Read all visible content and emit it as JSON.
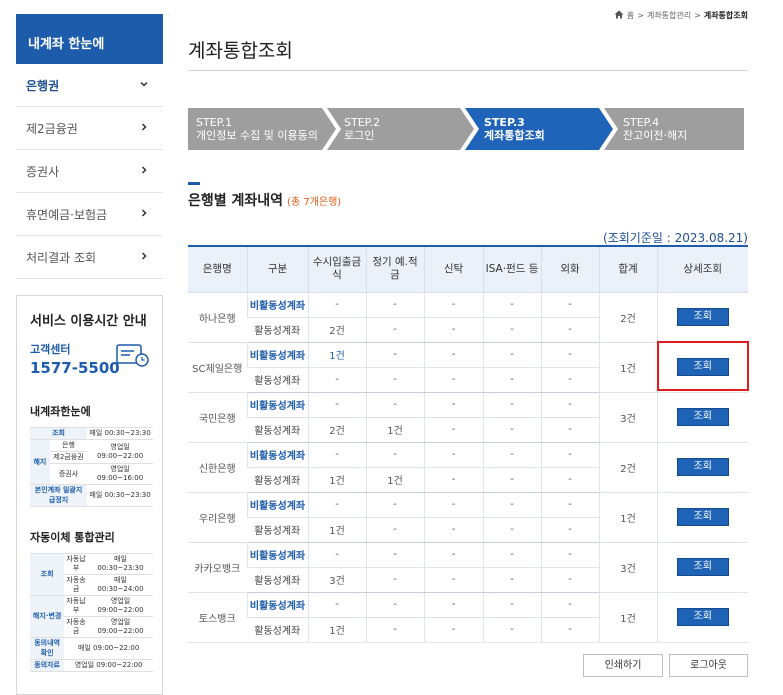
{
  "sidebar": {
    "header": "내계좌 한눈에",
    "items": [
      {
        "label": "은행권",
        "chevron": "⌄"
      },
      {
        "label": "제2금융권",
        "chevron": "›"
      },
      {
        "label": "증권사",
        "chevron": "›"
      },
      {
        "label": "휴면예금·보험금",
        "chevron": "›"
      },
      {
        "label": "처리결과 조회",
        "chevron": "›"
      }
    ],
    "service": {
      "title": "서비스 이용시간 안내",
      "center_label": "고객센터",
      "center_phone": "1577-5500",
      "section1_title": "내계좌한눈에",
      "section1_rows": [
        {
          "cat": "조회",
          "sub": "",
          "time": "매일 00:30~23:30"
        },
        {
          "cat": "해지",
          "sub": "은행",
          "time": "영업일 09:00~22:00"
        },
        {
          "cat": "",
          "sub": "제2금융권",
          "time": ""
        },
        {
          "cat": "",
          "sub": "증권사",
          "time": "영업일 09:00~16:00"
        },
        {
          "cat": "본인계좌 일괄지급정지",
          "sub": "",
          "time": "매일 00:30~23:30"
        }
      ],
      "section2_title": "자동이체 통합관리",
      "section2_rows": [
        {
          "cat": "조회",
          "sub": "자동납부",
          "time": "매일 00:30~23:30"
        },
        {
          "cat": "",
          "sub": "자동송금",
          "time": "매일 00:30~24:00"
        },
        {
          "cat": "해지·변경",
          "sub": "자동납부",
          "time": "영업일 09:00~22:00"
        },
        {
          "cat": "",
          "sub": "자동송금",
          "time": "영업일 09:00~22:00"
        },
        {
          "cat": "동의내역 확인",
          "sub": "",
          "time": "매일 09:00~22:00"
        },
        {
          "cat": "동의자료",
          "sub": "",
          "time": "영업일 09:00~22:00"
        }
      ]
    }
  },
  "breadcrumb": {
    "home_icon": "home-icon",
    "items": [
      "홈",
      "계좌통합관리",
      "계좌통합조회"
    ]
  },
  "page_title": "계좌통합조회",
  "steps": [
    {
      "line1": "STEP.1",
      "line2": "개인정보 수집 및 이용동의",
      "state": "done"
    },
    {
      "line1": "STEP.2",
      "line2": "로그인",
      "state": "done"
    },
    {
      "line1": "STEP.3",
      "line2": "계좌통합조회",
      "state": "current"
    },
    {
      "line1": "STEP.4",
      "line2": "잔고이전·해지",
      "state": "todo"
    }
  ],
  "section": {
    "title": "은행별 계좌내역",
    "count": "(총 7개은행)",
    "ref_date": "(조회기준일 : 2023.08.21)"
  },
  "table": {
    "headers": [
      "은행명",
      "구분",
      "수시입출금식",
      "정기 예.적금",
      "신탁",
      "ISA·펀드 등",
      "외화",
      "합계",
      "상세조회"
    ],
    "inactive_label": "비활동성계좌",
    "active_label": "활동성계좌",
    "view_label": "조회",
    "banks": [
      {
        "name": "하나은행",
        "inactive": [
          "-",
          "-",
          "-",
          "-",
          "-"
        ],
        "active": [
          "2건",
          "-",
          "-",
          "-",
          "-"
        ],
        "total": "2건"
      },
      {
        "name": "SC제일은행",
        "inactive": [
          "1건",
          "-",
          "-",
          "-",
          "-"
        ],
        "active": [
          "-",
          "-",
          "-",
          "-",
          "-"
        ],
        "total": "1건"
      },
      {
        "name": "국민은행",
        "inactive": [
          "-",
          "-",
          "-",
          "-",
          "-"
        ],
        "active": [
          "2건",
          "1건",
          "-",
          "-",
          "-"
        ],
        "total": "3건"
      },
      {
        "name": "신한은행",
        "inactive": [
          "-",
          "-",
          "-",
          "-",
          "-"
        ],
        "active": [
          "1건",
          "1건",
          "-",
          "-",
          "-"
        ],
        "total": "2건"
      },
      {
        "name": "우리은행",
        "inactive": [
          "-",
          "-",
          "-",
          "-",
          "-"
        ],
        "active": [
          "1건",
          "-",
          "-",
          "-",
          "-"
        ],
        "total": "1건"
      },
      {
        "name": "카카오뱅크",
        "inactive": [
          "-",
          "-",
          "-",
          "-",
          "-"
        ],
        "active": [
          "3건",
          "-",
          "-",
          "-",
          "-"
        ],
        "total": "3건"
      },
      {
        "name": "토스뱅크",
        "inactive": [
          "-",
          "-",
          "-",
          "-",
          "-"
        ],
        "active": [
          "1건",
          "-",
          "-",
          "-",
          "-"
        ],
        "total": "1건"
      }
    ]
  },
  "buttons": {
    "print": "인쇄하기",
    "logout": "로그아웃"
  },
  "colors": {
    "brand_blue": "#1d5cab",
    "step_gray": "#9e9e9e",
    "step_current": "#1f64b8",
    "highlight_red": "#e01e1e",
    "accent_orange": "#e25d1a"
  }
}
